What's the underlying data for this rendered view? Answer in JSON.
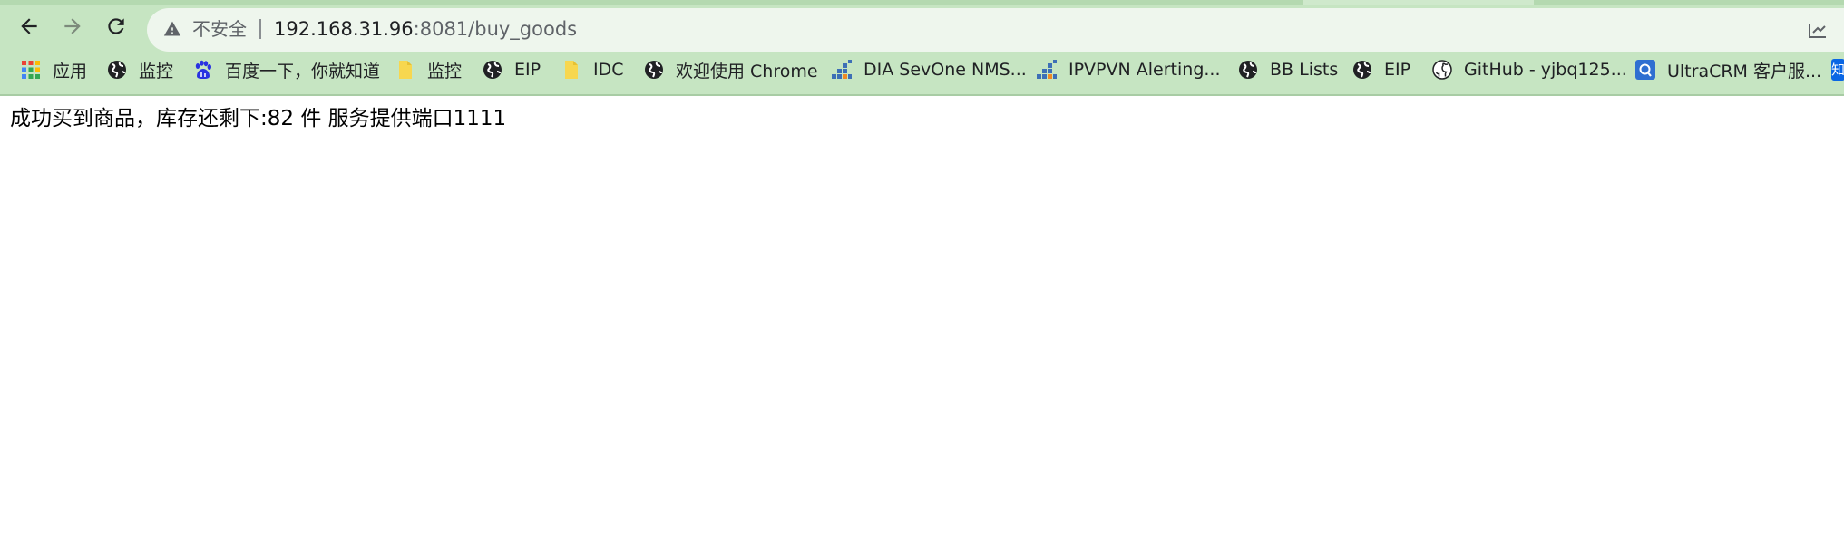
{
  "browser": {
    "omnibox": {
      "security_label": "不安全",
      "host": "192.168.31.96",
      "path": ":8081/buy_goods"
    },
    "bookmarks": [
      {
        "icon": "apps-grid-icon",
        "label": "应用"
      },
      {
        "icon": "globe-icon",
        "label": "监控"
      },
      {
        "icon": "baidu-icon",
        "label": "百度一下，你就知道"
      },
      {
        "icon": "folder-icon",
        "label": "监控"
      },
      {
        "icon": "globe-icon",
        "label": "EIP"
      },
      {
        "icon": "folder-icon",
        "label": "IDC"
      },
      {
        "icon": "globe-icon",
        "label": "欢迎使用 Chrome"
      },
      {
        "icon": "bar-chart-icon",
        "label": "DIA SevOne NMS..."
      },
      {
        "icon": "bar-chart-icon",
        "label": "IPVPVN Alerting..."
      },
      {
        "icon": "globe-icon",
        "label": "BB Lists"
      },
      {
        "icon": "globe-icon",
        "label": "EIP"
      },
      {
        "icon": "github-icon",
        "label": "GitHub - yjbq125..."
      },
      {
        "icon": "ultracrm-icon",
        "label": "UltraCRM 客户服..."
      },
      {
        "icon": "zhihu-icon",
        "label": "知"
      }
    ]
  },
  "page": {
    "message": "成功买到商品，库存还剩下:82 件 服务提供端口1111"
  }
}
